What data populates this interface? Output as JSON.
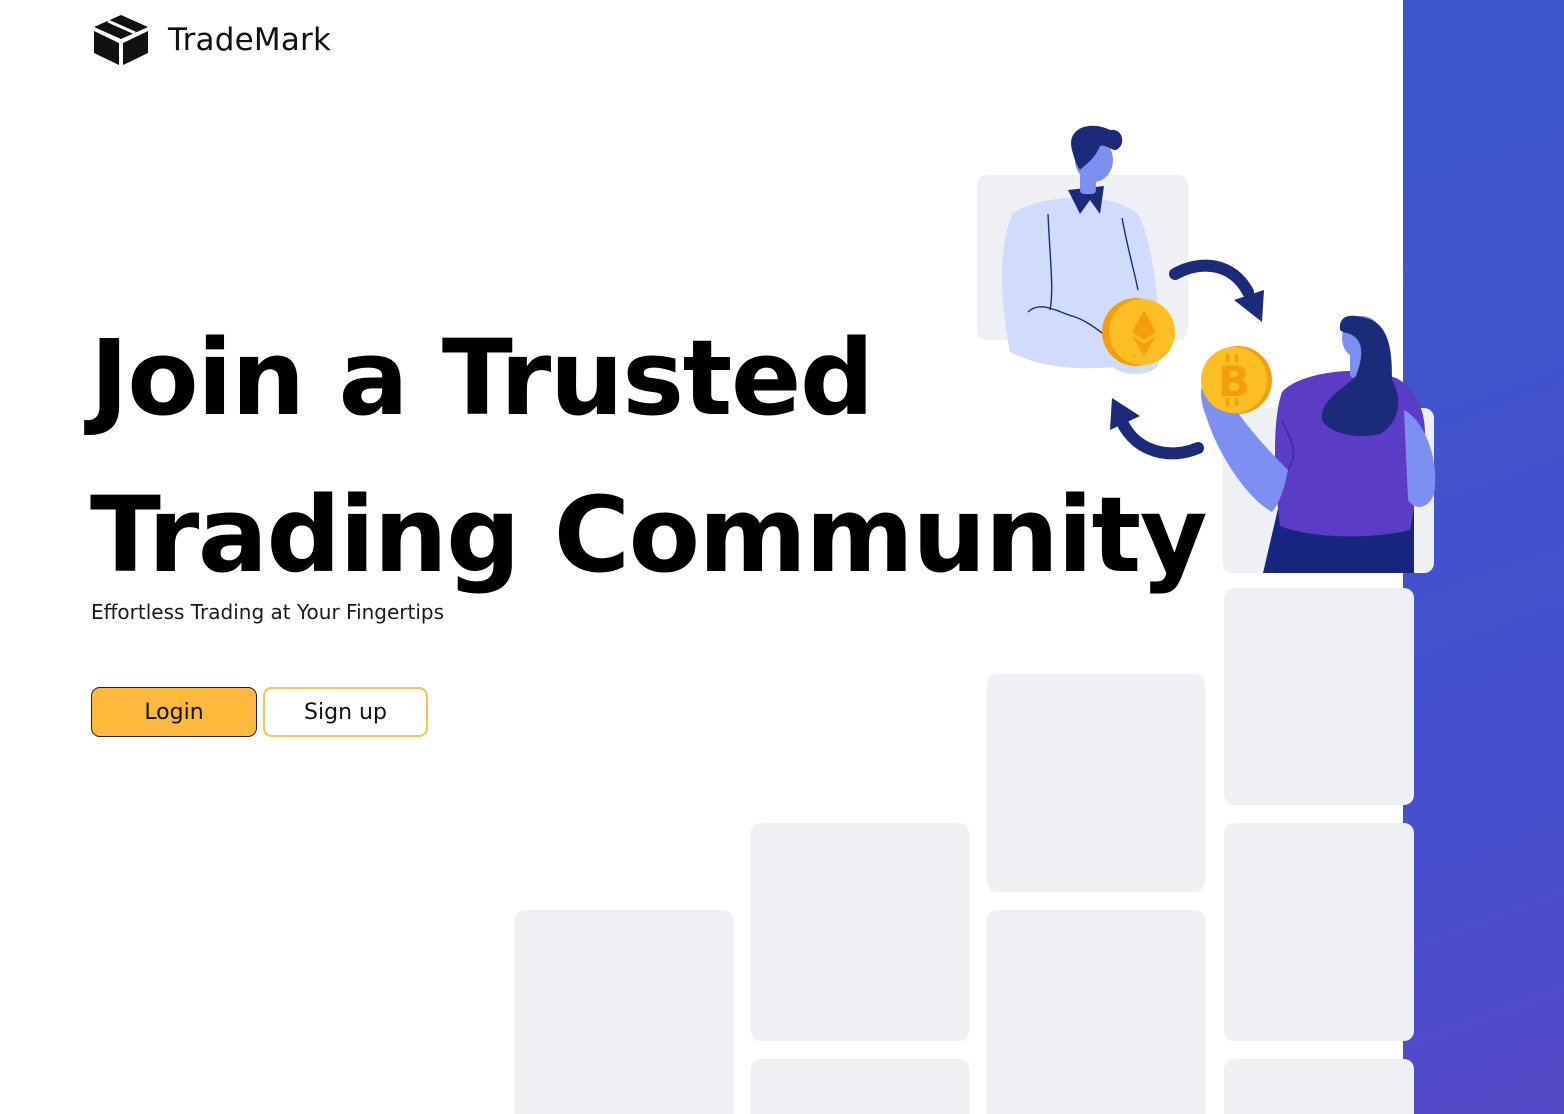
{
  "brand": {
    "name": "TradeMark",
    "logo_icon": "box-icon"
  },
  "hero": {
    "title_line1": "Join a Trusted",
    "title_line2": "Trading Community",
    "subtitle": "Effortless Trading at Your Fingertips"
  },
  "actions": {
    "login_label": "Login",
    "signup_label": "Sign up"
  },
  "illustration": {
    "description_icons": [
      "ethereum-coin-icon",
      "bitcoin-coin-icon",
      "exchange-arrows-icon"
    ]
  },
  "colors": {
    "accent_panel": "#3c57cc",
    "login_button": "#fdb93c",
    "signup_border": "#fdc04a",
    "tile": "#eff0f3",
    "coin": "#f7b52c",
    "arrow": "#1c2a7a"
  }
}
